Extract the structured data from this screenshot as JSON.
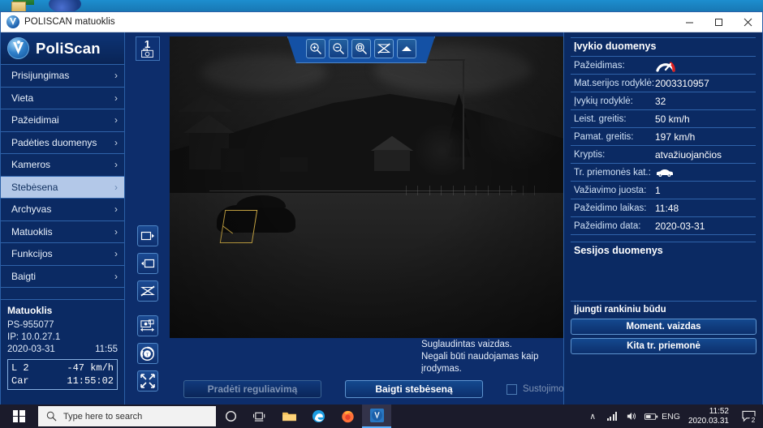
{
  "window": {
    "title": "POLISCAN matuoklis",
    "icon": "poliscan-app-icon",
    "minimize": "—",
    "maximize": "☐",
    "close": "✕"
  },
  "sidebar": {
    "brand": "PoliScan",
    "items": [
      {
        "label": "Prisijungimas",
        "chevron": "›",
        "active": false
      },
      {
        "label": "Vieta",
        "chevron": "›",
        "active": false
      },
      {
        "label": "Pažeidimai",
        "chevron": "›",
        "active": false
      },
      {
        "label": "Padėties duomenys",
        "chevron": "›",
        "active": false
      },
      {
        "label": "Kameros",
        "chevron": "›",
        "active": false
      },
      {
        "label": "Stebėsena",
        "chevron": "›",
        "active": true
      },
      {
        "label": "Archyvas",
        "chevron": "›",
        "active": false
      },
      {
        "label": "Matuoklis",
        "chevron": "›",
        "active": false
      },
      {
        "label": "Funkcijos",
        "chevron": "›",
        "active": false
      },
      {
        "label": "Baigti",
        "chevron": "›",
        "active": false
      }
    ],
    "status": {
      "title": "Matuoklis",
      "device_id": "PS-955077",
      "ip": "IP: 10.0.27.1",
      "date": "2020-03-31",
      "time": "11:55",
      "readout_lane": "L 2",
      "readout_speed": "-47 km/h",
      "readout_class": "Car",
      "readout_time": "11:55:02"
    }
  },
  "rail": {
    "camera_number": "1",
    "camera_icon": "camera-icon",
    "buttons": [
      {
        "name": "panel-right-icon"
      },
      {
        "name": "panel-left-icon"
      },
      {
        "name": "no-overlay-icon"
      },
      {
        "name": "image-pan-icon"
      },
      {
        "name": "aperture-refresh-icon"
      },
      {
        "name": "fullscreen-icon"
      }
    ]
  },
  "viewer": {
    "toolbar": [
      {
        "name": "zoom-in-icon"
      },
      {
        "name": "zoom-out-icon"
      },
      {
        "name": "zoom-fit-icon"
      },
      {
        "name": "hide-overlay-icon"
      },
      {
        "name": "collapse-toolbar-icon"
      }
    ],
    "note_line1": "Suglaudintas vaizdas.",
    "note_line2": "Negali būti naudojamas kaip įrodymas.",
    "measure_box_color": "#d8b348"
  },
  "actions": {
    "start_label": "Pradėti reguliavimą",
    "start_disabled": true,
    "stop_label": "Baigti stebėseną",
    "stop_disabled": false,
    "checkbox_label": "Sustojimo režimas",
    "checkbox_checked": false
  },
  "event_panel": {
    "title": "Įvykio duomenys",
    "rows": [
      {
        "label": "Pažeidimas:",
        "value": "",
        "icon": "speed-violation-gauge-icon"
      },
      {
        "label": "Mat.serijos rodyklė:",
        "value": "2003310957",
        "icon": ""
      },
      {
        "label": "Įvykių rodyklė:",
        "value": "32",
        "icon": ""
      },
      {
        "label": "Leist. greitis:",
        "value": "50 km/h",
        "icon": ""
      },
      {
        "label": "Pamat. greitis:",
        "value": "197 km/h",
        "icon": ""
      },
      {
        "label": "Kryptis:",
        "value": "atvažiuojančios",
        "icon": ""
      },
      {
        "label": "Tr. priemonės kat.:",
        "value": "",
        "icon": "car-category-icon"
      },
      {
        "label": "Važiavimo juosta:",
        "value": "1",
        "icon": ""
      },
      {
        "label": "Pažeidimo laikas:",
        "value": "11:48",
        "icon": ""
      },
      {
        "label": "Pažeidimo data:",
        "value": "2020-03-31",
        "icon": ""
      }
    ],
    "session_title": "Sesijos duomenys",
    "manual_title": "Įjungti rankiniu būdu",
    "manual_buttons": [
      {
        "label": "Moment. vaizdas"
      },
      {
        "label": "Kita tr. priemonė"
      }
    ]
  },
  "taskbar": {
    "search_placeholder": "Type here to search",
    "icons": [
      {
        "name": "cortana-icon"
      },
      {
        "name": "task-view-icon"
      },
      {
        "name": "file-explorer-icon"
      },
      {
        "name": "edge-browser-icon"
      },
      {
        "name": "firefox-browser-icon"
      },
      {
        "name": "poliscan-taskbar-icon"
      }
    ],
    "tray": {
      "chevron": "∧",
      "language": "ENG",
      "time": "11:52",
      "date": "2020.03.31",
      "notification_count": "2"
    }
  },
  "colors": {
    "panel_blue": "#0b2a63",
    "window_blue": "#0d2d6b",
    "accent_border": "#2f63aa",
    "active_item": "#b3c8e8",
    "violation_red": "#e02020"
  }
}
